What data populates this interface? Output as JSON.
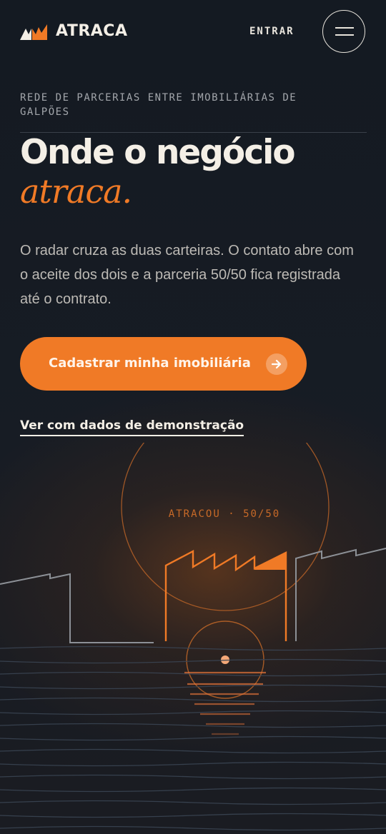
{
  "header": {
    "brand": "ATRACA",
    "login_label": "ENTRAR",
    "menu_icon": "menu-icon"
  },
  "hero": {
    "eyebrow": "REDE DE PARCERIAS ENTRE IMOBILIÁRIAS DE GALPÕES",
    "title": "Onde o negócio",
    "title_accent": "atraca.",
    "lead": "O radar cruza as duas carteiras. O contato abre com o aceite dos dois e a parceria 50/50 fica registrada até o contrato.",
    "cta_label": "Cadastrar minha imobiliária",
    "cta_icon": "arrow-right-icon",
    "demo_label": "Ver com dados de demonstração"
  },
  "illustration": {
    "badge": "ATRACOU · 50/50"
  },
  "colors": {
    "background": "#141a22",
    "accent": "#f07a26",
    "text": "#f4efe6",
    "muted": "#bdbab5"
  }
}
